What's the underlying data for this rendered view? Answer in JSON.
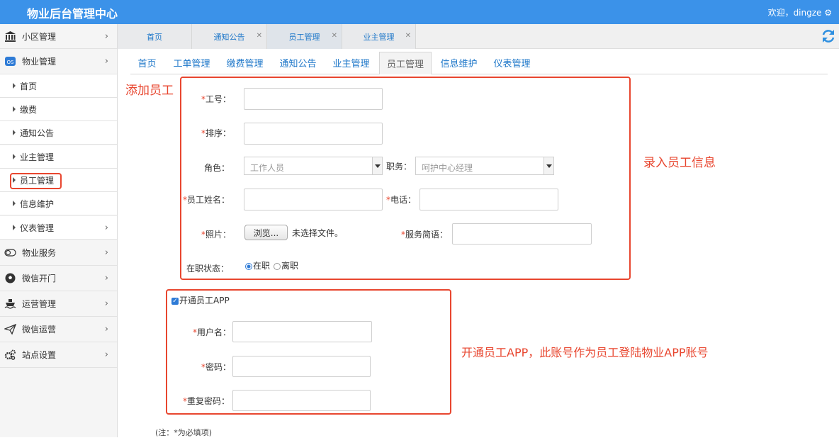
{
  "header": {
    "app_title": "物业后台管理中心",
    "welcome": "欢迎，dingze ⚙"
  },
  "sidebar": {
    "menus": [
      {
        "label": "小区管理",
        "icon": "bank-icon"
      },
      {
        "label": "物业管理",
        "icon": "os-icon"
      },
      {
        "label": "物业服务",
        "icon": "toggle-icon"
      },
      {
        "label": "微信开门",
        "icon": "soccer-icon"
      },
      {
        "label": "运营管理",
        "icon": "ship-icon"
      },
      {
        "label": "微信运营",
        "icon": "send-icon"
      },
      {
        "label": "站点设置",
        "icon": "gears-icon"
      }
    ],
    "sub_items": [
      "首页",
      "缴费",
      "通知公告",
      "业主管理",
      "员工管理",
      "信息维护",
      "仪表管理"
    ]
  },
  "tabs": [
    {
      "label": "首页"
    },
    {
      "label": "通知公告"
    },
    {
      "label": "员工管理"
    },
    {
      "label": "业主管理"
    }
  ],
  "subnav": [
    "首页",
    "工单管理",
    "缴费管理",
    "通知公告",
    "业主管理",
    "员工管理",
    "信息维护",
    "仪表管理"
  ],
  "annotations": {
    "add_employee": "添加员工",
    "enter_info": "录入员工信息",
    "app_account": "开通员工APP，此账号作为员工登陆物业APP账号"
  },
  "form": {
    "required_mark": "*",
    "job_no_label": "工号：",
    "sort_label": "排序：",
    "role_label": "角色：",
    "role_value": "工作人员",
    "position_label": "职务：",
    "position_value": "呵护中心经理",
    "name_label": "员工姓名：",
    "phone_label": "电话：",
    "photo_label": "照片：",
    "browse_button": "浏览...",
    "no_file": "未选择文件。",
    "service_label": "服务简语：",
    "status_label": "在职状态：",
    "status_on": "在职",
    "status_off": "离职",
    "app_checkbox": "开通员工APP",
    "username_label": "用户名：",
    "password_label": "密码：",
    "repeat_password_label": "重复密码：",
    "note": "(注：*为必填项)"
  },
  "colors": {
    "topbar": "#3b92e9",
    "link": "#1e77c9",
    "annotation": "#e8462f"
  }
}
